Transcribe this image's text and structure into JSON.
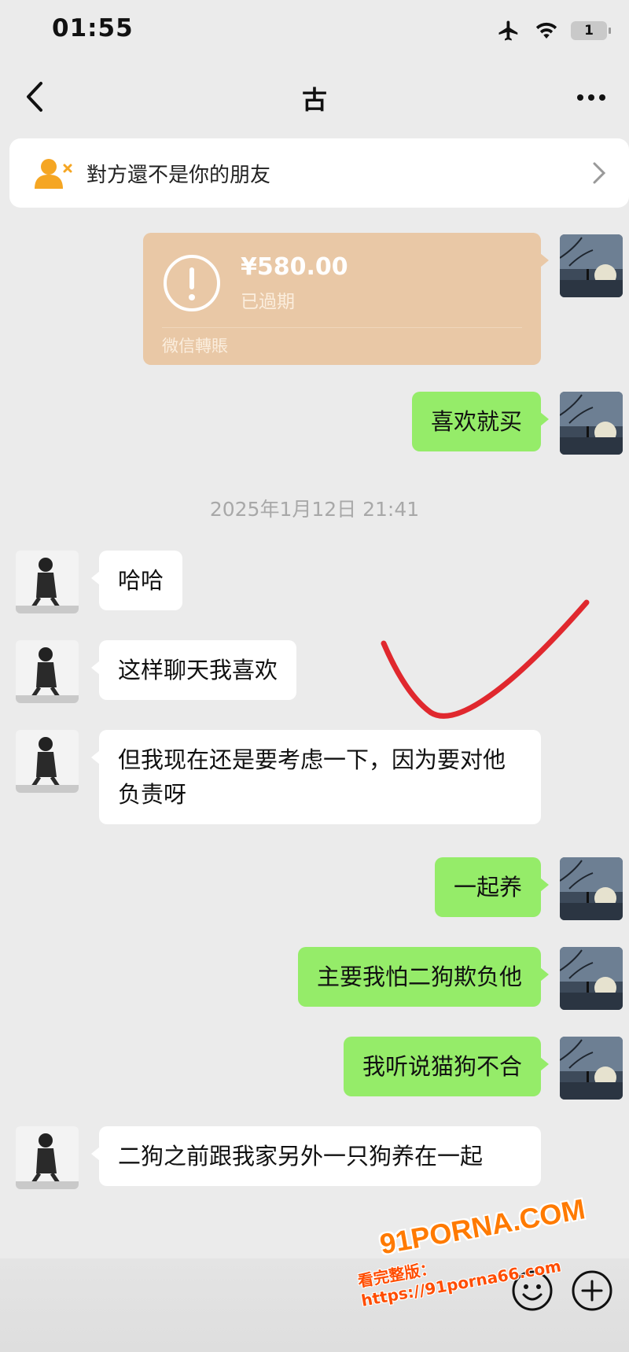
{
  "status_bar": {
    "time": "01:55",
    "battery": "1"
  },
  "header": {
    "title": "古"
  },
  "notice": {
    "text": "對方還不是你的朋友"
  },
  "transfer": {
    "amount": "¥580.00",
    "status": "已過期",
    "label": "微信轉賬"
  },
  "timestamp": "2025年1月12日 21:41",
  "messages": [
    {
      "sender": "me",
      "text": "喜欢就买"
    },
    {
      "sender": "them",
      "text": "哈哈"
    },
    {
      "sender": "them",
      "text": "这样聊天我喜欢"
    },
    {
      "sender": "them",
      "text": "但我现在还是要考虑一下，因为要对他负责呀"
    },
    {
      "sender": "me",
      "text": "一起养"
    },
    {
      "sender": "me",
      "text": "主要我怕二狗欺负他"
    },
    {
      "sender": "me",
      "text": "我听说猫狗不合"
    },
    {
      "sender": "them",
      "text": "二狗之前跟我家另外一只狗养在一起"
    }
  ],
  "watermark": {
    "brand": "91PORNA.COM",
    "url": "看完整版：https://91porna66.com"
  },
  "colors": {
    "my_bubble": "#95ec69",
    "their_bubble": "#ffffff",
    "transfer_card": "#e9c8a6",
    "annotation_stroke": "#e0282e"
  }
}
